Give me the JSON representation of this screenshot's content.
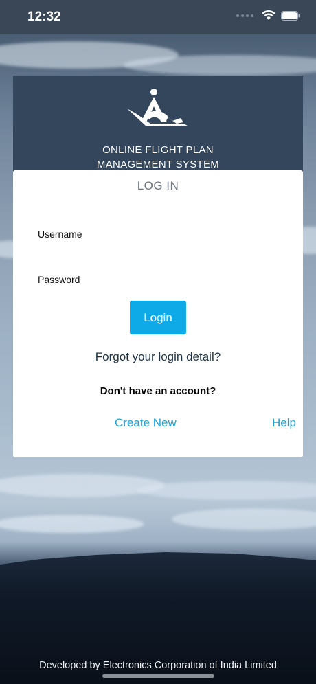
{
  "status_bar": {
    "time": "12:32"
  },
  "header": {
    "title_line1": "ONLINE FLIGHT PLAN",
    "title_line2": "MANAGEMENT SYSTEM"
  },
  "login": {
    "heading": "LOG IN",
    "username_label": "Username",
    "username_value": "",
    "password_label": "Password",
    "password_value": "",
    "login_button": "Login",
    "forgot_link": "Forgot your login detail?",
    "no_account_text": "Don't have an account?",
    "create_new_link": "Create New",
    "help_link": "Help"
  },
  "footer": {
    "text": "Developed by Electronics Corporation of India Limited"
  },
  "colors": {
    "accent": "#0eaae8",
    "link": "#1aa2d9",
    "header_bg": "#33465c",
    "status_bg": "#3a4757"
  },
  "icons": [
    "wifi-icon",
    "battery-icon",
    "signal-icon",
    "aai-logo"
  ]
}
